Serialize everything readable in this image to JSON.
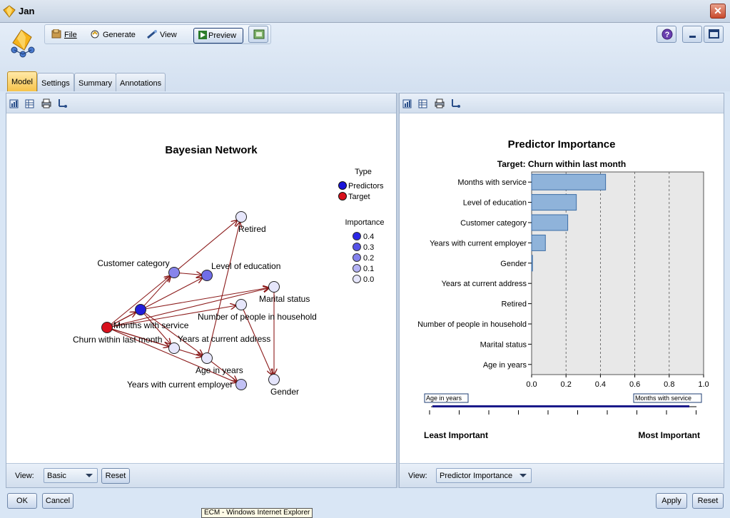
{
  "window": {
    "title": "Jan"
  },
  "menu": {
    "file": "File",
    "generate": "Generate",
    "view": "View",
    "preview": "Preview"
  },
  "tabs": [
    "Model",
    "Settings",
    "Summary",
    "Annotations"
  ],
  "left_pane": {
    "view_label": "View:",
    "view_value": "Basic",
    "reset_label": "Reset",
    "network": {
      "title": "Bayesian Network",
      "legend_type_title": "Type",
      "legend_types": [
        {
          "label": "Predictors",
          "color": "#1a14d8"
        },
        {
          "label": "Target",
          "color": "#d8101c"
        }
      ],
      "legend_importance_title": "Importance",
      "legend_importance": [
        "0.4",
        "0.3",
        "0.2",
        "0.1",
        "0.0"
      ],
      "nodes": [
        {
          "id": "retired",
          "label": "Retired",
          "importance": 0.0
        },
        {
          "id": "customer_category",
          "label": "Customer category",
          "importance": 0.21
        },
        {
          "id": "level_of_education",
          "label": "Level of education",
          "importance": 0.26
        },
        {
          "id": "marital_status",
          "label": "Marital status",
          "importance": 0.0
        },
        {
          "id": "months_with_service",
          "label": "Months with service",
          "importance": 0.43
        },
        {
          "id": "people_in_household",
          "label": "Number of people in household",
          "importance": 0.0
        },
        {
          "id": "churn",
          "label": "Churn within last month",
          "importance": null,
          "target": true
        },
        {
          "id": "years_at_address",
          "label": "Years at current address",
          "importance": 0.0
        },
        {
          "id": "age",
          "label": "Age in years",
          "importance": 0.0
        },
        {
          "id": "years_with_employer",
          "label": "Years with current employer",
          "importance": 0.08
        },
        {
          "id": "gender",
          "label": "Gender",
          "importance": 0.005
        }
      ]
    }
  },
  "right_pane": {
    "view_label": "View:",
    "view_value": "Predictor Importance",
    "least_important": "Least Important",
    "most_important": "Most Important",
    "scale_left_tag": "Age in years",
    "scale_right_tag": "Months with service"
  },
  "chart_data": {
    "type": "bar",
    "orientation": "horizontal",
    "title": "Predictor Importance",
    "subtitle": "Target: Churn within last month",
    "categories": [
      "Months with service",
      "Level of education",
      "Customer category",
      "Years with current employer",
      "Gender",
      "Years at current address",
      "Retired",
      "Number of people in household",
      "Marital status",
      "Age in years"
    ],
    "values": [
      0.43,
      0.26,
      0.21,
      0.08,
      0.005,
      0.0,
      0.0,
      0.0,
      0.0,
      0.0
    ],
    "xlim": [
      0,
      1.0
    ],
    "xticks": [
      "0.0",
      "0.2",
      "0.4",
      "0.6",
      "0.8",
      "1.0"
    ],
    "grid": "vertical dashed",
    "bar_color": "#8fb3da"
  },
  "footer": {
    "ok": "OK",
    "cancel": "Cancel",
    "apply": "Apply",
    "reset": "Reset",
    "taskbar_tooltip": "ECM - Windows Internet Explorer"
  }
}
